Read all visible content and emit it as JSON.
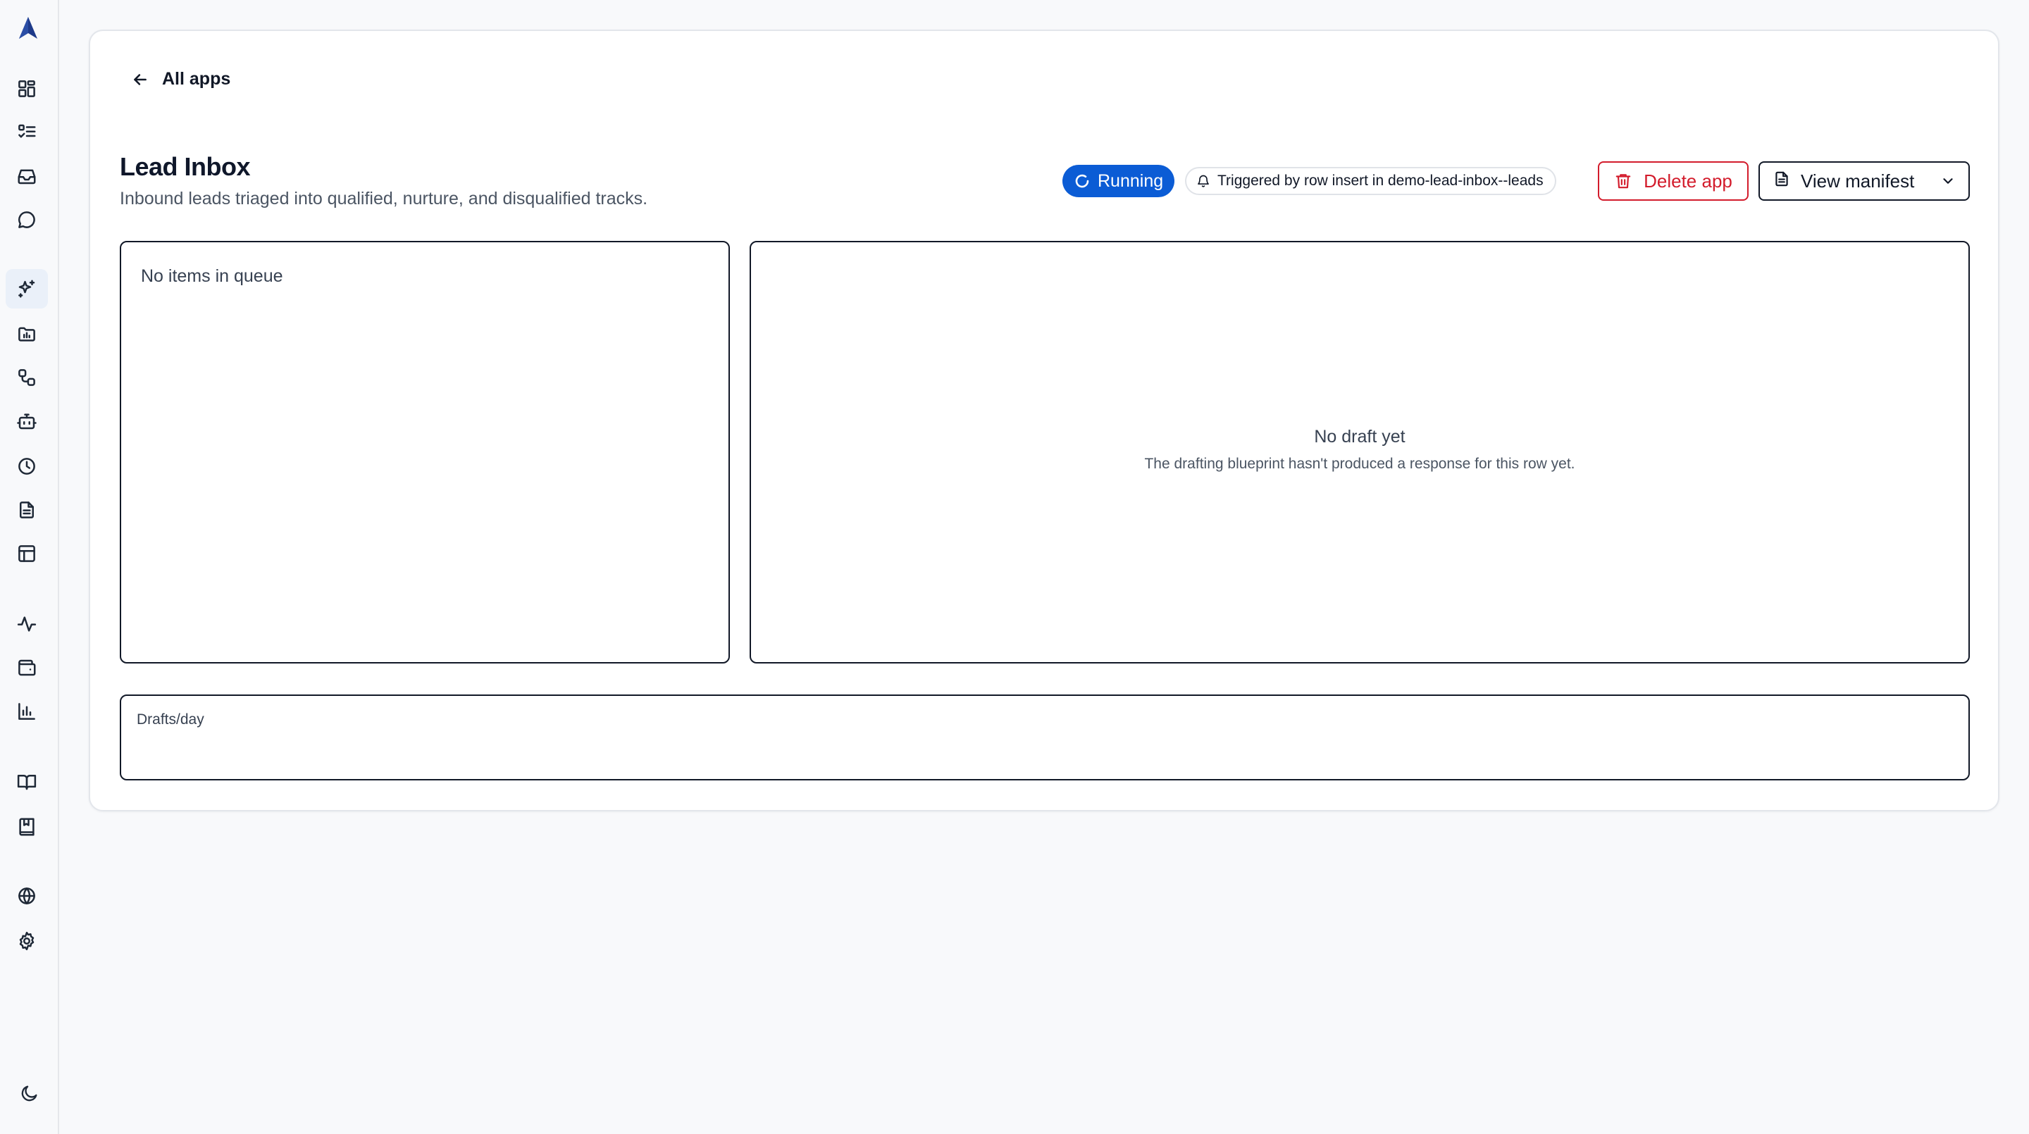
{
  "sidebar": {
    "logo": "app-logo",
    "items": [
      {
        "name": "dashboard",
        "icon": "grid-icon"
      },
      {
        "name": "tasks",
        "icon": "checklist-icon"
      },
      {
        "name": "inbox",
        "icon": "inbox-icon"
      },
      {
        "name": "chat",
        "icon": "chat-bubble-icon"
      },
      {
        "name": "apps",
        "icon": "sparkles-icon",
        "active": true
      },
      {
        "name": "projects",
        "icon": "folder-chart-icon"
      },
      {
        "name": "workflows",
        "icon": "workflow-icon"
      },
      {
        "name": "agents",
        "icon": "bot-icon"
      },
      {
        "name": "schedules",
        "icon": "clock-icon"
      },
      {
        "name": "documents",
        "icon": "document-icon"
      },
      {
        "name": "tables",
        "icon": "table-icon"
      },
      {
        "name": "activity",
        "icon": "activity-icon"
      },
      {
        "name": "wallet",
        "icon": "wallet-icon"
      },
      {
        "name": "analytics",
        "icon": "bar-chart-icon"
      },
      {
        "name": "docs",
        "icon": "book-open-icon"
      },
      {
        "name": "bookmarks",
        "icon": "book-bookmark-icon"
      },
      {
        "name": "web",
        "icon": "globe-icon"
      },
      {
        "name": "settings",
        "icon": "gear-icon"
      }
    ],
    "theme_toggle_icon": "moon-icon"
  },
  "header": {
    "back_label": "All apps",
    "title": "Lead Inbox",
    "description": "Inbound leads triaged into qualified, nurture, and disqualified tracks.",
    "status_label": "Running",
    "trigger_label": "Triggered by row insert in demo-lead-inbox--leads",
    "delete_label": "Delete app",
    "manifest_label": "View manifest"
  },
  "queue": {
    "empty_text": "No items in queue"
  },
  "draft": {
    "empty_title": "No draft yet",
    "empty_subtitle": "The drafting blueprint hasn't produced a response for this row yet."
  },
  "metrics": {
    "label": "Drafts/day"
  },
  "colors": {
    "accent": "#0b5cd5",
    "danger": "#d31c2c",
    "background": "#f8f9fb",
    "text": "#111827"
  }
}
